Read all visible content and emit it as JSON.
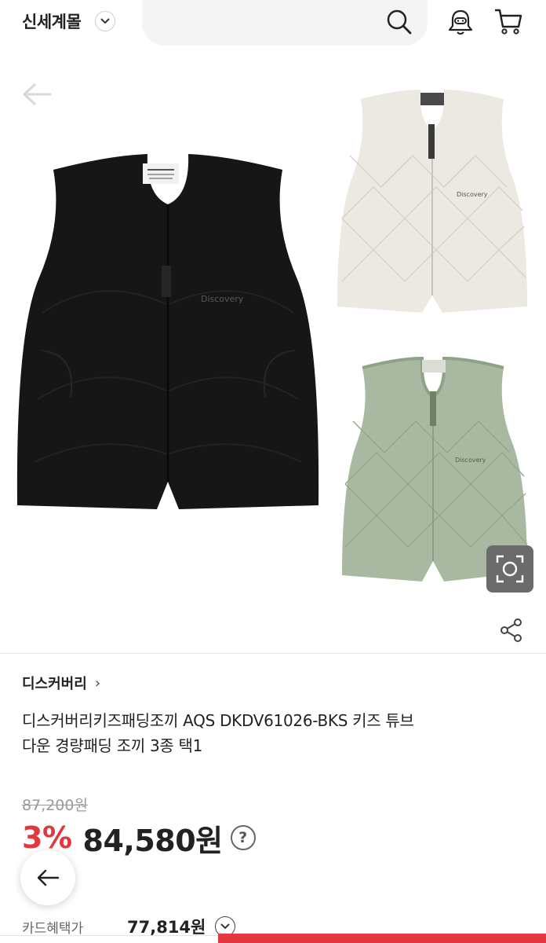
{
  "header": {
    "mall_name": "신세계몰",
    "icons": [
      "chevron-down-icon",
      "search-icon",
      "bell-icon",
      "cart-icon"
    ]
  },
  "gallery": {
    "images": [
      {
        "name": "black vest",
        "color": "#141414",
        "logo": "Discovery"
      },
      {
        "name": "cream vest",
        "color": "#ebe8e1",
        "logo": "Discovery"
      },
      {
        "name": "green vest",
        "color": "#a7b89f",
        "logo": "Discovery"
      }
    ]
  },
  "product": {
    "brand": "디스커버리",
    "brand_chevron": "›",
    "title_line1": "디스커버리키즈패딩조끼 AQS DKDV61026-BKS 키즈 튜브",
    "title_line2": "다운 경량패딩 조끼 3종 택1",
    "original_price": "87,200원",
    "discount": "3%",
    "sale_price": "84,580원",
    "help_icon": "?",
    "card_benefit_label": "카드혜택가",
    "card_benefit_price": "77,814원"
  },
  "colors": {
    "accent": "#e0383e",
    "bottom_button": "#e33841"
  }
}
